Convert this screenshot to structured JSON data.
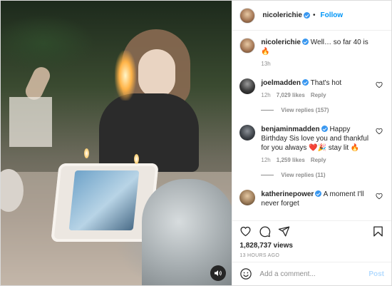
{
  "post": {
    "author": "nicolerichie",
    "follow_label": "Follow",
    "caption": {
      "username": "nicolerichie",
      "text": "Well… so far 40 is 🔥",
      "age": "13h"
    },
    "comments": [
      {
        "username": "joelmadden",
        "verified": true,
        "text": "That's hot",
        "age": "12h",
        "likes": "7,029 likes",
        "reply_label": "Reply",
        "view_replies": "View replies (157)"
      },
      {
        "username": "benjaminmadden",
        "verified": true,
        "text": "Happy Birthday Sis love you and thankful for you always ❤️🎉 stay lit 🔥",
        "age": "12h",
        "likes": "1,259 likes",
        "reply_label": "Reply",
        "view_replies": "View replies (11)"
      },
      {
        "username": "katherinepower",
        "verified": true,
        "text": "A moment I'll never forget"
      }
    ],
    "likes_count": "1,828,737 views",
    "timestamp": "13 HOURS AGO",
    "add_comment_placeholder": "Add a comment...",
    "post_label": "Post"
  },
  "colors": {
    "accent": "#0095f6",
    "verified": "#3897f0",
    "muted": "#8e8e8e"
  },
  "icons": {
    "sound": "speaker-icon",
    "like": "heart-icon",
    "comment": "comment-icon",
    "share": "paper-plane-icon",
    "save": "bookmark-icon",
    "emoji": "smiley-icon"
  }
}
